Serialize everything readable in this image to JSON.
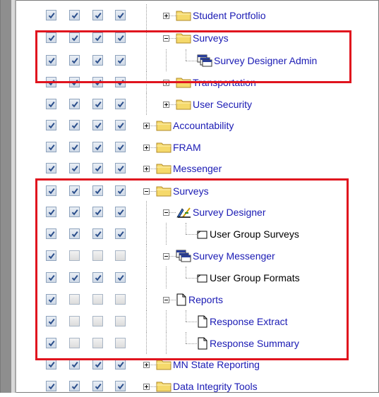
{
  "tree": {
    "rows": [
      {
        "label": "Student Portfolio",
        "checks": [
          true,
          true,
          true,
          true
        ]
      },
      {
        "label": "Surveys",
        "checks": [
          true,
          true,
          true,
          true
        ]
      },
      {
        "label": "Survey Designer Admin",
        "checks": [
          true,
          true,
          true,
          true
        ]
      },
      {
        "label": "Transportation",
        "checks": [
          true,
          true,
          true,
          true
        ]
      },
      {
        "label": "User Security",
        "checks": [
          true,
          true,
          true,
          true
        ]
      },
      {
        "label": "Accountability",
        "checks": [
          true,
          true,
          true,
          true
        ]
      },
      {
        "label": "FRAM",
        "checks": [
          true,
          true,
          true,
          true
        ]
      },
      {
        "label": "Messenger",
        "checks": [
          true,
          true,
          true,
          true
        ]
      },
      {
        "label": "Surveys",
        "checks": [
          true,
          true,
          true,
          true
        ]
      },
      {
        "label": "Survey Designer",
        "checks": [
          true,
          true,
          true,
          true
        ]
      },
      {
        "label": "User Group Surveys",
        "checks": [
          true,
          true,
          true,
          true
        ]
      },
      {
        "label": "Survey Messenger",
        "checks": [
          true,
          false,
          false,
          false
        ]
      },
      {
        "label": "User Group Formats",
        "checks": [
          true,
          true,
          true,
          true
        ]
      },
      {
        "label": "Reports",
        "checks": [
          true,
          false,
          false,
          false
        ]
      },
      {
        "label": "Response Extract",
        "checks": [
          true,
          false,
          false,
          false
        ]
      },
      {
        "label": "Response Summary",
        "checks": [
          true,
          false,
          false,
          false
        ]
      },
      {
        "label": "MN State Reporting",
        "checks": [
          true,
          true,
          true,
          true
        ]
      },
      {
        "label": "Data Integrity Tools",
        "checks": [
          true,
          true,
          true,
          true
        ]
      }
    ]
  },
  "colors": {
    "link": "#1a1ab4",
    "highlight": "#e0141e",
    "folder": "#f5d96b"
  }
}
